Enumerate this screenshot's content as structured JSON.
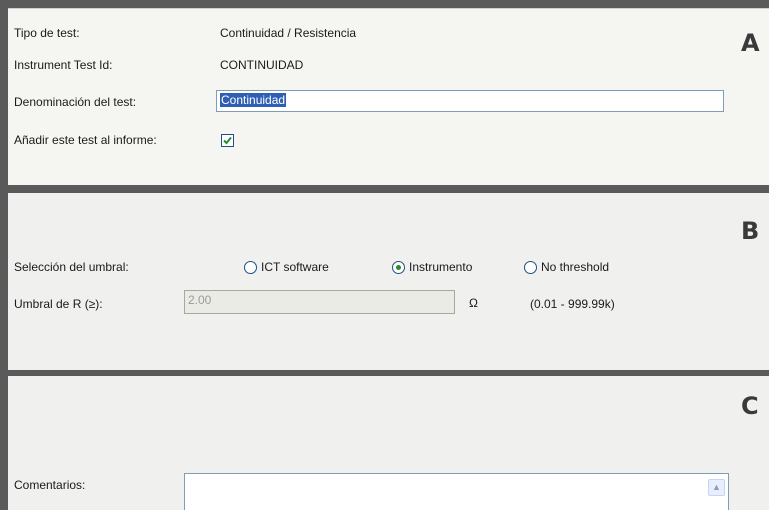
{
  "section_a": {
    "letter": "A",
    "tipo_label": "Tipo de test:",
    "tipo_value": "Continuidad / Resistencia",
    "instrument_label": "Instrument Test Id:",
    "instrument_value": "CONTINUIDAD",
    "denominacion_label": "Denominación del test:",
    "denominacion_value": "Continuidad",
    "anadir_label": "Añadir este test al informe:",
    "anadir_checked": true
  },
  "section_b": {
    "letter": "B",
    "seleccion_label": "Selección del umbral:",
    "options": [
      {
        "label": "ICT software",
        "selected": false
      },
      {
        "label": "Instrumento",
        "selected": true
      },
      {
        "label": "No threshold",
        "selected": false
      }
    ],
    "umbral_label": "Umbral de R (≥):",
    "umbral_value": "2.00",
    "unit": "Ω",
    "range": "(0.01 - 999.99k)"
  },
  "section_c": {
    "letter": "C",
    "comentarios_label": "Comentarios:",
    "comentarios_value": ""
  },
  "icons": {
    "check": "checkmark-icon",
    "scroll_up": "scroll-up-arrow-icon"
  },
  "colors": {
    "selection": "#2f5fb4",
    "radio_dot": "#2b8b2b",
    "check": "#2b8b2b"
  }
}
